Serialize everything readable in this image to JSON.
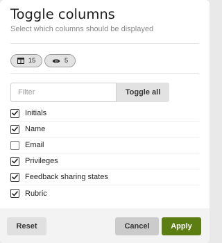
{
  "dialog": {
    "title": "Toggle columns",
    "subtitle": "Select which columns should be displayed"
  },
  "chips": [
    {
      "icon": "columns-icon",
      "count": "15"
    },
    {
      "icon": "eye-icon",
      "count": "5"
    }
  ],
  "filter": {
    "placeholder": "Filter",
    "value": "",
    "toggle_all_label": "Toggle all"
  },
  "columns": [
    {
      "label": "Initials",
      "checked": true
    },
    {
      "label": "Name",
      "checked": true
    },
    {
      "label": "Email",
      "checked": false
    },
    {
      "label": "Privileges",
      "checked": true
    },
    {
      "label": "Feedback sharing states",
      "checked": true
    },
    {
      "label": "Rubric",
      "checked": true
    }
  ],
  "footer": {
    "reset_label": "Reset",
    "cancel_label": "Cancel",
    "apply_label": "Apply"
  },
  "colors": {
    "apply": "#5c7d12",
    "chip_bg": "#e2e2e2",
    "footer_bg": "#f3f3f3"
  }
}
